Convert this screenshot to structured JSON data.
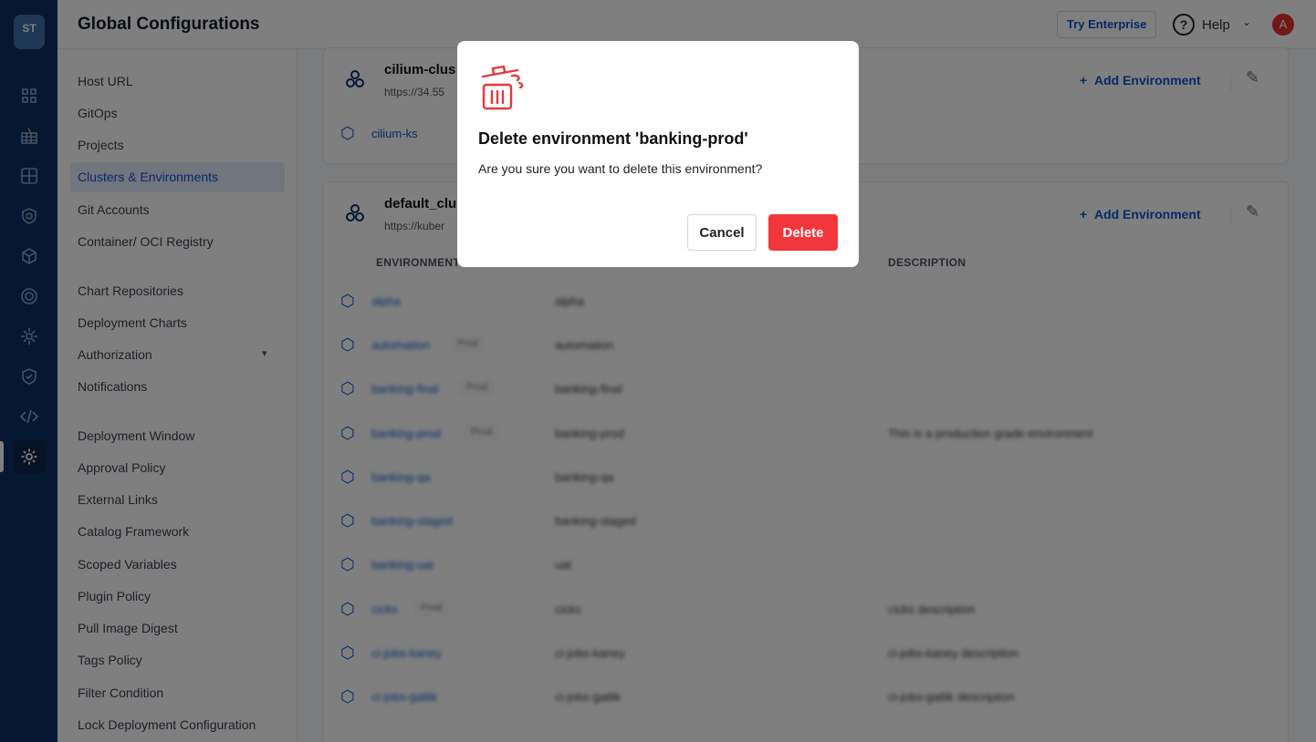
{
  "header": {
    "title": "Global Configurations",
    "try_enterprise": "Try Enterprise",
    "help_label": "Help",
    "avatar_initial": "A"
  },
  "rail": {
    "logo": "ST",
    "icons": [
      "apps-icon",
      "app-groups-icon",
      "application-grid-icon",
      "security-icon",
      "cube-icon",
      "resource-watcher-icon",
      "stack-manager-icon",
      "shield-check-icon",
      "code-icon",
      "gear-icon"
    ],
    "active": "gear-icon"
  },
  "nav": {
    "items": [
      "Host URL",
      "GitOps",
      "Projects",
      "Clusters & Environments",
      "Git Accounts",
      "Container/ OCI Registry",
      "Chart Repositories",
      "Deployment Charts",
      "Authorization",
      "Notifications",
      "Deployment Window",
      "Approval Policy",
      "External Links",
      "Catalog Framework",
      "Scoped Variables",
      "Plugin Policy",
      "Pull Image Digest",
      "Tags Policy",
      "Filter Condition",
      "Lock Deployment Configuration"
    ],
    "active": "Clusters & Environments"
  },
  "clusters": [
    {
      "name": "cilium-clus",
      "url": "https://34.55",
      "add_env": "Add Environment",
      "environments": [
        "cilium-ks"
      ]
    },
    {
      "name": "default_clu",
      "url": "https://kuber",
      "add_env": "Add Environment",
      "table_headers": {
        "environment": "ENVIRONMENT",
        "description": "DESCRIPTION"
      },
      "rows": [
        {
          "name": "alpha",
          "tag": "",
          "ns": "alpha",
          "desc": ""
        },
        {
          "name": "automation",
          "tag": "Prod",
          "ns": "automation",
          "desc": ""
        },
        {
          "name": "banking-final",
          "tag": "Prod",
          "ns": "banking-final",
          "desc": ""
        },
        {
          "name": "banking-prod",
          "tag": "Prod",
          "ns": "banking-prod",
          "desc": "This is a production grade environment"
        },
        {
          "name": "banking-qa",
          "tag": "",
          "ns": "banking-qa",
          "desc": ""
        },
        {
          "name": "banking-staged",
          "tag": "",
          "ns": "banking-staged",
          "desc": ""
        },
        {
          "name": "banking-uat",
          "tag": "",
          "ns": "uat",
          "desc": ""
        },
        {
          "name": "cicks",
          "tag": "Prod",
          "ns": "cicks",
          "desc": "cicks description"
        },
        {
          "name": "ci-jobs-kaney",
          "tag": "",
          "ns": "ci-jobs-kaney",
          "desc": "ci-jobs-kaney description"
        },
        {
          "name": "ci-jobs-gatlik",
          "tag": "",
          "ns": "ci-jobs-gatlik",
          "desc": "ci-jobs-gatlik description"
        }
      ]
    }
  ],
  "dialog": {
    "title": "Delete environment 'banking-prod'",
    "message": "Are you sure you want to delete this environment?",
    "cancel_label": "Cancel",
    "delete_label": "Delete",
    "accent_color": "#f1373b"
  }
}
